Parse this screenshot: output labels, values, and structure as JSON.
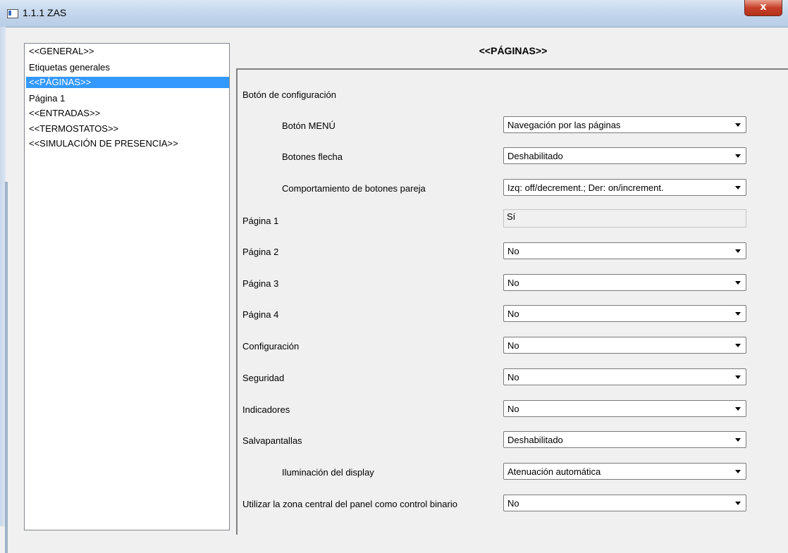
{
  "window": {
    "title": "1.1.1 ZAS",
    "close_glyph": "x"
  },
  "tree": {
    "items": [
      {
        "label": "<<GENERAL>>",
        "selected": false
      },
      {
        "label": "Etiquetas generales",
        "selected": false
      },
      {
        "label": "<<PÁGINAS>>",
        "selected": true
      },
      {
        "label": "Página 1",
        "selected": false
      },
      {
        "label": "<<ENTRADAS>>",
        "selected": false
      },
      {
        "label": "<<TERMOSTATOS>>",
        "selected": false
      },
      {
        "label": "<<SIMULACIÓN DE PRESENCIA>>",
        "selected": false
      }
    ]
  },
  "main": {
    "title": "<<PÁGINAS>>",
    "section_label": "Botón de configuración",
    "rows": [
      {
        "label": "Botón MENÚ",
        "value": "Navegación por las páginas"
      },
      {
        "label": "Botones flecha",
        "value": "Deshabilitado"
      },
      {
        "label": "Comportamiento de botones pareja",
        "value": "Izq: off/decrement.; Der: on/increment."
      },
      {
        "label": "Página 1",
        "value": "Sí"
      },
      {
        "label": "Página 2",
        "value": "No"
      },
      {
        "label": "Página 3",
        "value": "No"
      },
      {
        "label": "Página 4",
        "value": "No"
      },
      {
        "label": "Configuración",
        "value": "No"
      },
      {
        "label": "Seguridad",
        "value": "No"
      },
      {
        "label": "Indicadores",
        "value": "No"
      },
      {
        "label": "Salvapantallas",
        "value": "Deshabilitado"
      },
      {
        "label": "Iluminación del display",
        "value": "Atenuación automática"
      },
      {
        "label": "Utilizar la zona central del panel como control binario",
        "value": "No"
      }
    ]
  }
}
